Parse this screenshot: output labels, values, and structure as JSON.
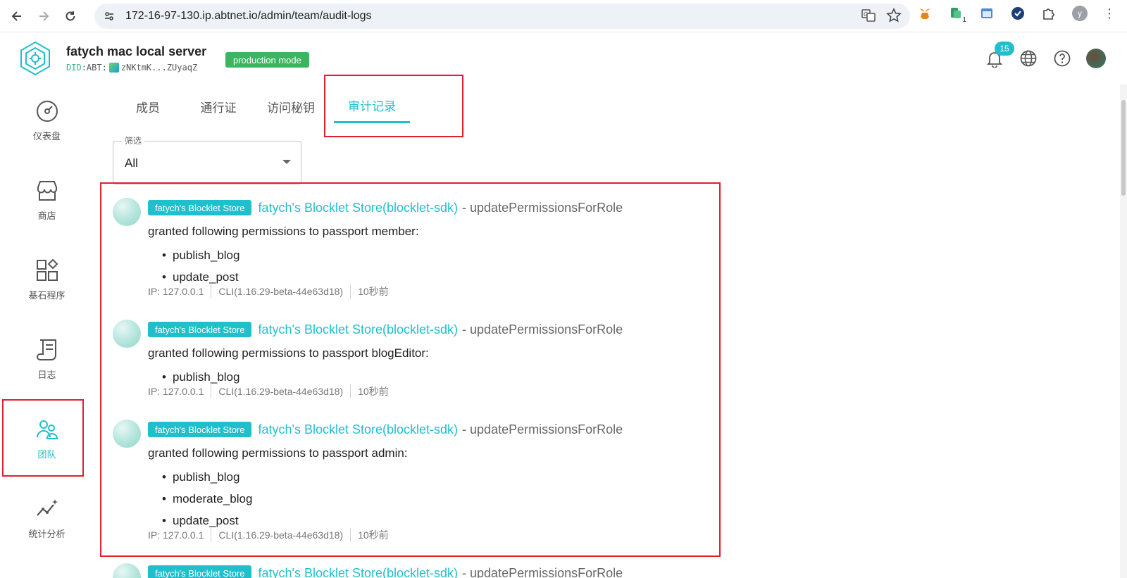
{
  "browser": {
    "url": "172-16-97-130.ip.abtnet.io/admin/team/audit-logs",
    "profile_initial": "y",
    "extension_badge": "1"
  },
  "header": {
    "server_name": "fatych mac local server",
    "did_prefix": "DID",
    "did_type": ":ABT:",
    "did_value": "zNKtmK...ZUyaqZ",
    "mode_badge": "production mode",
    "notification_count": "15"
  },
  "sidebar": {
    "items": [
      {
        "label": "仪表盘",
        "icon": "dashboard-icon"
      },
      {
        "label": "商店",
        "icon": "store-icon"
      },
      {
        "label": "基石程序",
        "icon": "blocklets-icon"
      },
      {
        "label": "日志",
        "icon": "logs-icon"
      },
      {
        "label": "团队",
        "icon": "team-icon",
        "active": true
      },
      {
        "label": "统计分析",
        "icon": "analytics-icon"
      }
    ]
  },
  "tabs": [
    {
      "label": "成员"
    },
    {
      "label": "通行证"
    },
    {
      "label": "访问秘钥"
    },
    {
      "label": "审计记录",
      "active": true
    }
  ],
  "filter": {
    "label": "筛选",
    "value": "All"
  },
  "logs": [
    {
      "tag": "fatych's Blocklet Store",
      "source": "fatych's Blocklet Store(blocklet-sdk)",
      "action": "- updatePermissionsForRole",
      "description": "granted following permissions to passport member:",
      "permissions": [
        "publish_blog",
        "update_post"
      ],
      "ip": "IP: 127.0.0.1",
      "client": "CLI(1.16.29-beta-44e63d18)",
      "time": "10秒前"
    },
    {
      "tag": "fatych's Blocklet Store",
      "source": "fatych's Blocklet Store(blocklet-sdk)",
      "action": "- updatePermissionsForRole",
      "description": "granted following permissions to passport blogEditor:",
      "permissions": [
        "publish_blog"
      ],
      "ip": "IP: 127.0.0.1",
      "client": "CLI(1.16.29-beta-44e63d18)",
      "time": "10秒前"
    },
    {
      "tag": "fatych's Blocklet Store",
      "source": "fatych's Blocklet Store(blocklet-sdk)",
      "action": "- updatePermissionsForRole",
      "description": "granted following permissions to passport admin:",
      "permissions": [
        "publish_blog",
        "moderate_blog",
        "update_post"
      ],
      "ip": "IP: 127.0.0.1",
      "client": "CLI(1.16.29-beta-44e63d18)",
      "time": "10秒前"
    },
    {
      "tag": "fatych's Blocklet Store",
      "source": "fatych's Blocklet Store(blocklet-sdk)",
      "action": "- updatePermissionsForRole"
    }
  ],
  "colors": {
    "accent": "#1fbfcb",
    "mode_badge": "#3bb55f",
    "highlight": "#e0202a"
  }
}
